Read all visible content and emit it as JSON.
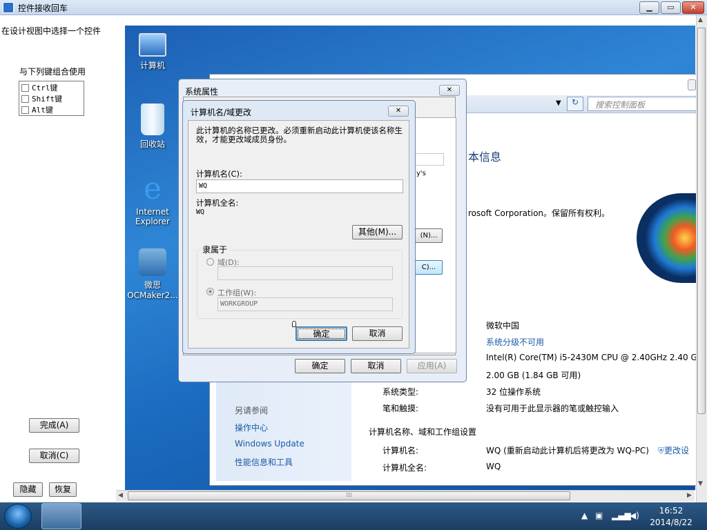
{
  "app": {
    "title": "控件接收回车",
    "hint": "在设计视图中选择一个控件",
    "combo_label": "与下列键组合使用",
    "keys": [
      "Ctrl键",
      "Shift键",
      "Alt键"
    ],
    "done": "完成(A)",
    "cancel": "取消(C)",
    "hide": "隐藏",
    "restore": "恢复",
    "min": "▁",
    "max": "▭",
    "close": "✕"
  },
  "desktop": {
    "icons": [
      {
        "label": "计算机"
      },
      {
        "label": "回收站"
      },
      {
        "label": "Internet Explorer"
      },
      {
        "label": "微思 OCMaker2..."
      }
    ]
  },
  "control_panel": {
    "search_placeholder": "搜索控制面板",
    "heading": "本信息",
    "copyright": "rosoft Corporation。保留所有权利。",
    "frag1": "y's",
    "btn_frag1": "(N)...",
    "btn_frag2": "C)...",
    "see_also": "另请参阅",
    "links": [
      "操作中心",
      "Windows Update",
      "性能信息和工具"
    ],
    "rows": [
      {
        "label": "",
        "value": "微软中国"
      },
      {
        "label": "",
        "value": "系统分级不可用"
      },
      {
        "label": "",
        "value": "Intel(R) Core(TM) i5-2430M CPU @ 2.40GHz   2.40 G"
      },
      {
        "label": "",
        "value": "2.00 GB (1.84 GB 可用)"
      },
      {
        "label": "系统类型:",
        "value": "32 位操作系统"
      },
      {
        "label": "笔和触摸:",
        "value": "没有可用于此显示器的笔或触控输入"
      }
    ],
    "section": "计算机名称、域和工作组设置",
    "name_label": "计算机名:",
    "name_value": "WQ (重新启动此计算机后将更改为 WQ-PC)",
    "change_link": "更改设",
    "fullname_label": "计算机全名:",
    "fullname_value": "WQ"
  },
  "sys_dialog": {
    "title": "系统属性",
    "ok": "确定",
    "cancel": "取消",
    "apply": "应用(A)"
  },
  "cn_dialog": {
    "title": "计算机名/域更改",
    "notice": "此计算机的名称已更改。必须重新启动此计算机使该名称生效，才能更改域成员身份。",
    "name_label": "计算机名(C):",
    "name_value": "WQ",
    "full_label": "计算机全名:",
    "full_value": "WQ",
    "more": "其他(M)...",
    "member_of": "隶属于",
    "domain_label": "域(D):",
    "workgroup_label": "工作组(W):",
    "workgroup_value": "WORKGROUP",
    "ok": "确定",
    "cancel": "取消"
  },
  "taskbar": {
    "time": "16:52",
    "date": "2014/8/22"
  }
}
